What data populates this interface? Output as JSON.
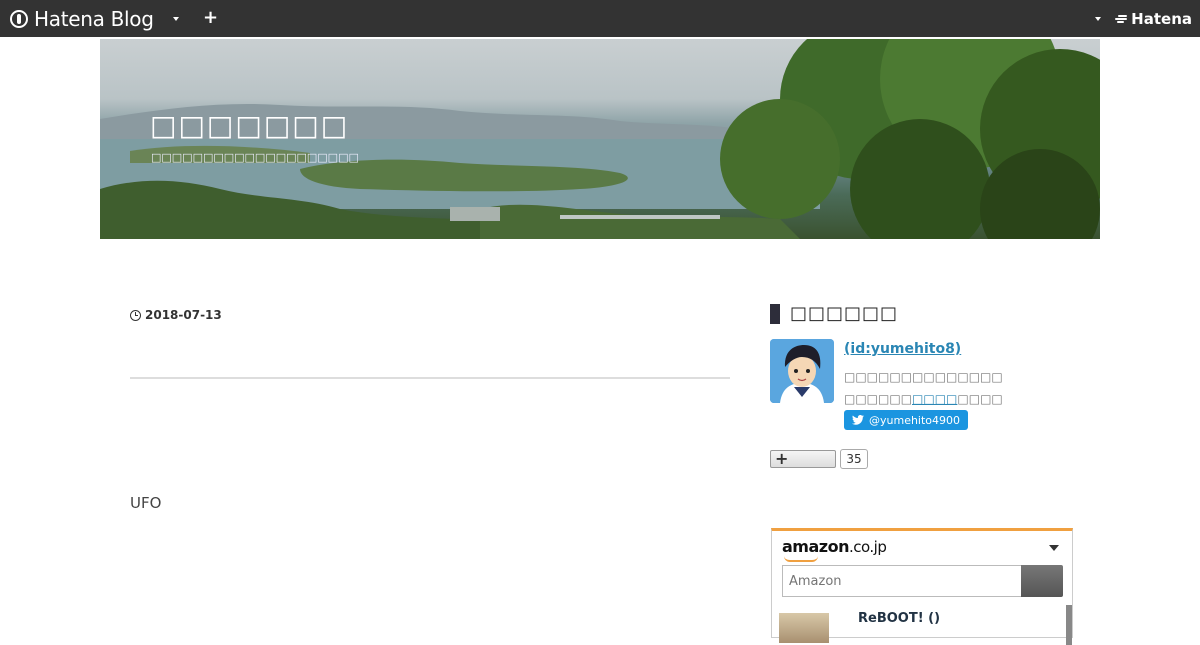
{
  "topbar": {
    "logo": "Hatena Blog",
    "add_label": "+",
    "brand": "Hatena"
  },
  "header": {
    "title": "□□□□□□□",
    "description": "□□□□□□□□□□□□□□□□□□□□"
  },
  "entry": {
    "date": "2018-07-13",
    "body": "UFO"
  },
  "sidebar": {
    "profile_heading": "□□□□□□",
    "profile_id": " (id:yumehito8)",
    "profile_line1": "□□□□□□□□□□□□□□",
    "profile_line2_pre": "□□□□□□",
    "profile_line2_link": "□□□□",
    "profile_line2_post": "□□□□",
    "twitter_handle": "@yumehito4900",
    "follow_label": "+",
    "follower_count": "35"
  },
  "amazon": {
    "logo": "amazon",
    "logo_suffix": ".co.jp",
    "search_placeholder": "Amazon",
    "item_title": "ReBOOT!  ()"
  },
  "colors": {
    "topbar": "#333333",
    "link": "#2a86b4",
    "twitter": "#1b95e0",
    "amazon_accent": "#f0a040"
  }
}
